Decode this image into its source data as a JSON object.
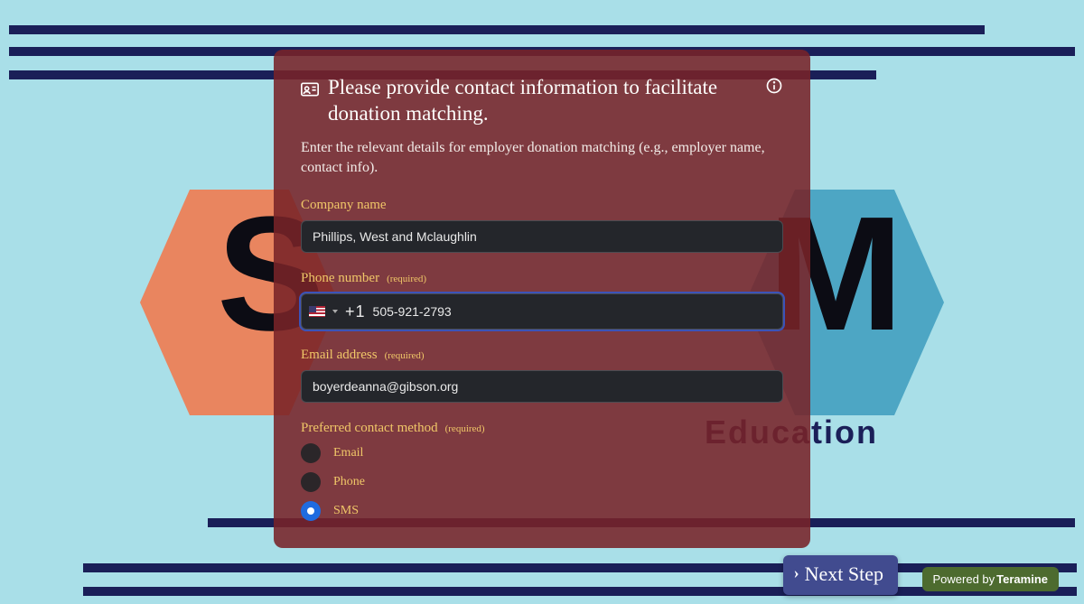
{
  "background": {
    "education_label": "Education",
    "letters": {
      "s": "S",
      "m": "M"
    }
  },
  "form": {
    "title": "Please provide contact information to facilitate donation matching.",
    "subtitle": "Enter the relevant details for employer donation matching (e.g., employer name, contact info).",
    "required_label": "(required)",
    "company": {
      "label": "Company name",
      "value": "Phillips, West and Mclaughlin"
    },
    "phone": {
      "label": "Phone number",
      "dial_code": "+1",
      "value": "505-921-2793"
    },
    "email": {
      "label": "Email address",
      "value": "boyerdeanna@gibson.org"
    },
    "contact_method": {
      "label": "Preferred contact method",
      "options": {
        "email": "Email",
        "phone": "Phone",
        "sms": "SMS"
      },
      "selected": "sms"
    }
  },
  "actions": {
    "next": "Next Step"
  },
  "footer": {
    "powered_by": "Powered by",
    "brand": "Teramine"
  }
}
